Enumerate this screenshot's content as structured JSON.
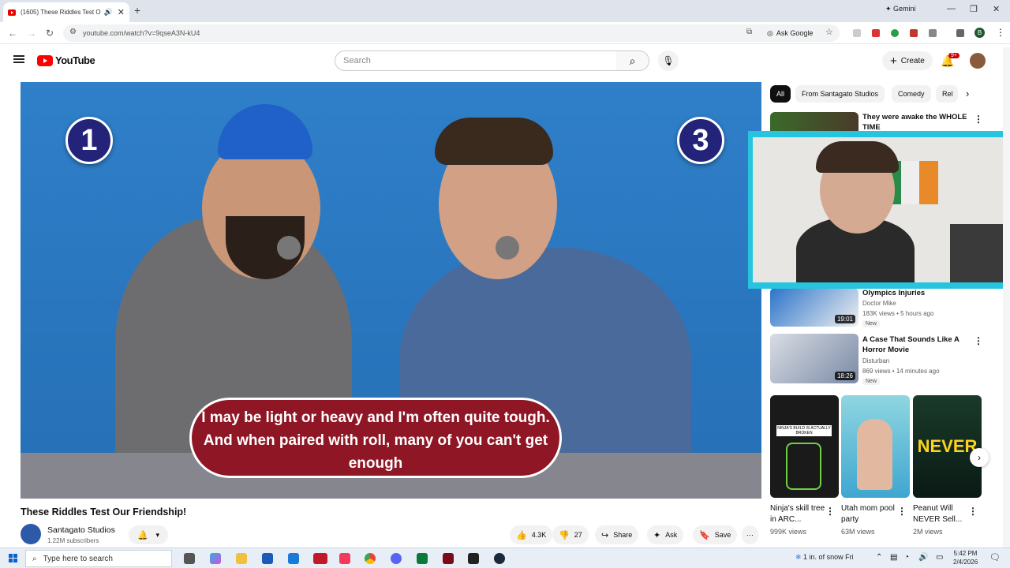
{
  "browser": {
    "tab_title": "(1605) These Riddles Test O",
    "new_tab": "+",
    "gemini": "Gemini",
    "url": "youtube.com/watch?v=9qseA3N-kU4",
    "ask_google": "Ask Google",
    "profile_letter": "B"
  },
  "yt": {
    "logo": "YouTube",
    "search_placeholder": "Search",
    "create": "Create",
    "notif_count": "9+"
  },
  "player": {
    "left_number": "1",
    "right_number": "3",
    "caption": "I may be light or heavy and I'm often quite tough. And when paired with roll, many of you can't get enough"
  },
  "video": {
    "title": "These Riddles Test Our Friendship!",
    "channel": "Santagato Studios",
    "subscribers": "1.22M subscribers",
    "likes": "4.3K",
    "dislikes": "27",
    "share": "Share",
    "ask": "Ask",
    "save": "Save"
  },
  "chips": [
    "All",
    "From Santagato Studios",
    "Comedy",
    "Rel"
  ],
  "recommendations": [
    {
      "title": "They were awake the WHOLE TIME",
      "channel": "",
      "meta": "",
      "duration": "",
      "new": ""
    },
    {
      "title": "Olympics Injuries",
      "channel": "Doctor Mike",
      "meta": "183K views • 5 hours ago",
      "duration": "19:01",
      "new": "New"
    },
    {
      "title": "A Case That Sounds Like A Horror Movie",
      "channel": "Disturban",
      "meta": "869 views • 14 minutes ago",
      "duration": "18:26",
      "new": "New"
    }
  ],
  "shorts": [
    {
      "title": "Ninja's skill tree in ARC...",
      "views": "999K views",
      "overlay": "NINJA'S BUILD IS ACTUALLY BROKEN"
    },
    {
      "title": "Utah mom pool party",
      "views": "63M views",
      "overlay": ""
    },
    {
      "title": "Peanut Will NEVER Sell...",
      "views": "2M views",
      "overlay": "NEVER"
    }
  ],
  "taskbar": {
    "search_placeholder": "Type here to search",
    "weather": "1 in. of snow Fri",
    "time": "5:42 PM",
    "date": "2/4/2026"
  }
}
